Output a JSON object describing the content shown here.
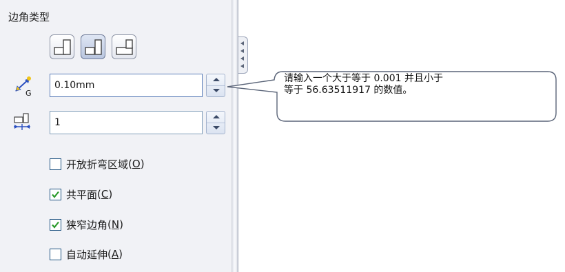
{
  "panel": {
    "section_title": "边角类型",
    "corner_buttons": [
      {
        "name": "overlap-corner",
        "active": false
      },
      {
        "name": "underlap-corner",
        "active": true
      },
      {
        "name": "butt-corner",
        "active": false
      }
    ],
    "gap_field": {
      "value": "0.10mm",
      "icon": "gap-distance-icon"
    },
    "overlap_ratio_field": {
      "value": "1",
      "icon": "overlap-ratio-icon"
    },
    "checkboxes": [
      {
        "label": "开放折弯区域",
        "mnemonic": "O",
        "checked": false
      },
      {
        "label": "共平面",
        "mnemonic": "C",
        "checked": true
      },
      {
        "label": "狭窄边角",
        "mnemonic": "N",
        "checked": true
      },
      {
        "label": "自动延伸",
        "mnemonic": "A",
        "checked": false
      }
    ]
  },
  "tooltip": {
    "line1": "请输入一个大于等于 0.001 并且小于",
    "line2": "等于 56.63511917 的数值。"
  },
  "colors": {
    "panel_bg": "#f1f2f6",
    "check_mark": "#2b9a2b",
    "tooltip_border": "#5a6478"
  }
}
